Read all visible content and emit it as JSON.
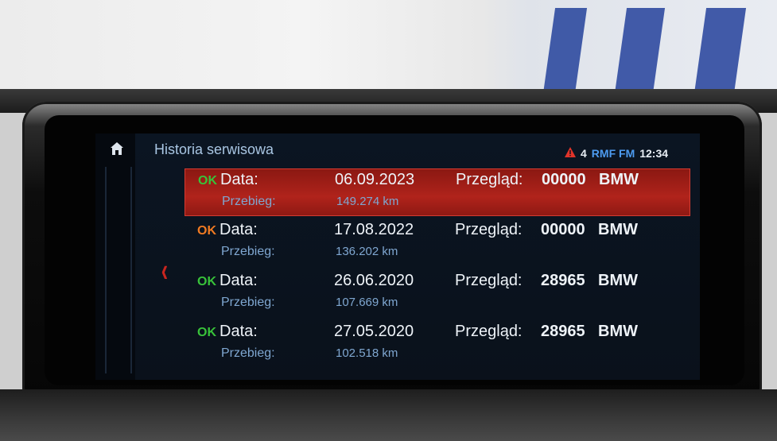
{
  "screen": {
    "title": "Historia serwisowa",
    "status": {
      "warning_icon": "warning-triangle-icon",
      "warning_count": "4",
      "radio": "RMF FM",
      "clock": "12:34"
    }
  },
  "nav": {
    "home_icon": "home-icon",
    "back_icon": "chevron-left-icon"
  },
  "rows": [
    {
      "status": "OK",
      "status_color": "#38c23a",
      "data_label": "Data:",
      "date": "06.09.2023",
      "mileage_label": "Przebieg:",
      "mileage": "149.274 km",
      "inspection_label": "Przegląd:",
      "inspection": "00000",
      "brand": "BMW",
      "selected": true
    },
    {
      "status": "OK",
      "status_color": "#f07a22",
      "data_label": "Data:",
      "date": "17.08.2022",
      "mileage_label": "Przebieg:",
      "mileage": "136.202 km",
      "inspection_label": "Przegląd:",
      "inspection": "00000",
      "brand": "BMW",
      "selected": false
    },
    {
      "status": "OK",
      "status_color": "#38c23a",
      "data_label": "Data:",
      "date": "26.06.2020",
      "mileage_label": "Przebieg:",
      "mileage": "107.669 km",
      "inspection_label": "Przegląd:",
      "inspection": "28965",
      "brand": "BMW",
      "selected": false
    },
    {
      "status": "OK",
      "status_color": "#38c23a",
      "data_label": "Data:",
      "date": "27.05.2020",
      "mileage_label": "Przebieg:",
      "mileage": "102.518 km",
      "inspection_label": "Przegląd:",
      "inspection": "28965",
      "brand": "BMW",
      "selected": false
    }
  ],
  "colors": {
    "selected_row": "#b0231b",
    "accent_blue": "#4d9bf0",
    "warning": "#e0342a"
  }
}
